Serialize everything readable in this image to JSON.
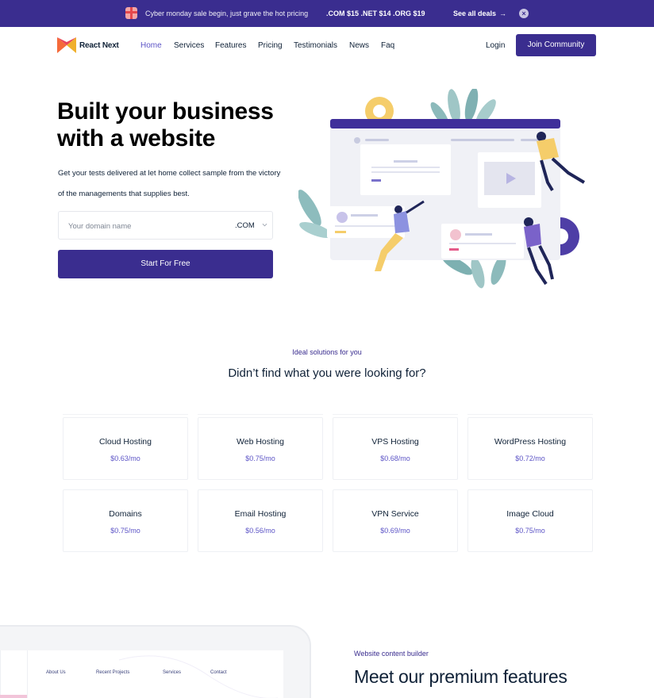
{
  "promo": {
    "message": "Cyber monday sale begin, just grave the hot pricing",
    "prices": ".COM $15 .NET $14 .ORG $19",
    "link_label": "See all deals",
    "link_arrow": "→",
    "close_icon": "×",
    "background": "#3a2d8f"
  },
  "nav": {
    "brand": "React Next",
    "items": [
      "Home",
      "Services",
      "Features",
      "Pricing",
      "Testimonials",
      "News",
      "Faq"
    ],
    "active_item": "Home",
    "login": "Login",
    "cta": "Join Community"
  },
  "hero": {
    "title": "Built your business with a website",
    "description": "Get your tests delivered at let home collect sample from the victory of the managements that supplies best.",
    "domain_placeholder": "Your domain name",
    "domain_value": "",
    "tld_selected": ".COM",
    "button": "Start For Free"
  },
  "solutions": {
    "subtitle": "Ideal solutions for you",
    "title": "Didn’t find what you were looking for?",
    "cards": [
      {
        "name": "Cloud Hosting",
        "price": "$0.63/mo"
      },
      {
        "name": "Web Hosting",
        "price": "$0.75/mo"
      },
      {
        "name": "VPS Hosting",
        "price": "$0.68/mo"
      },
      {
        "name": "WordPress Hosting",
        "price": "$0.72/mo"
      },
      {
        "name": "Domains",
        "price": "$0.75/mo"
      },
      {
        "name": "Email Hosting",
        "price": "$0.56/mo"
      },
      {
        "name": "VPN Service",
        "price": "$0.69/mo"
      },
      {
        "name": "Image Cloud",
        "price": "$0.75/mo"
      }
    ]
  },
  "features": {
    "mockup_nav": [
      "About Us",
      "Recent Projects",
      "Services",
      "Contact"
    ],
    "subtitle": "Website content builder",
    "title": "Meet our premium features"
  },
  "colors": {
    "primary": "#3a2d8f",
    "accent": "#5d55c6",
    "heading": "#0f2137"
  }
}
